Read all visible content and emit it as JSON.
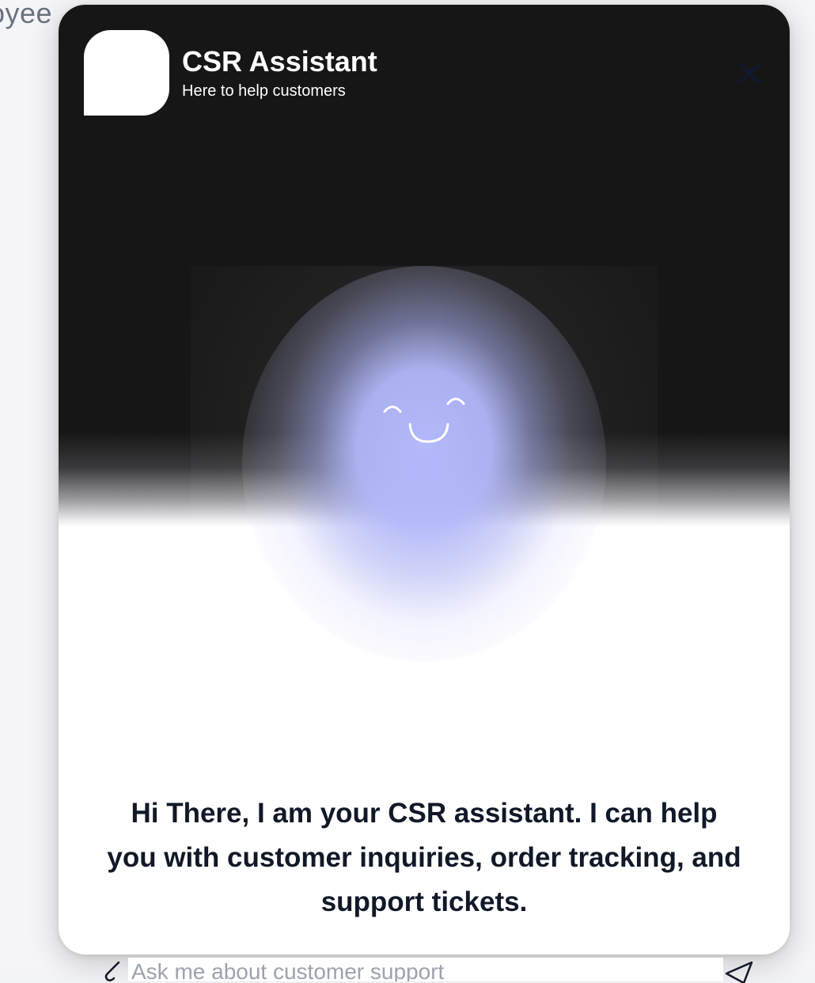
{
  "background": {
    "partial_text": "oyee"
  },
  "assistant": {
    "name": "CSR Assistant",
    "tagline": "Here to help customers",
    "greeting": "Hi There, I am your CSR assistant. I can help you with customer inquiries, order tracking, and support tickets."
  },
  "input": {
    "placeholder": "Ask me about customer support"
  },
  "icons": {
    "close": "close-icon",
    "face": "smiley-face-icon",
    "attach": "paperclip-icon",
    "send": "send-icon"
  },
  "colors": {
    "header_bg": "#161617",
    "orb": "#b2b8fa",
    "text_dark": "#111827",
    "close_icon": "#0f1a3a"
  }
}
